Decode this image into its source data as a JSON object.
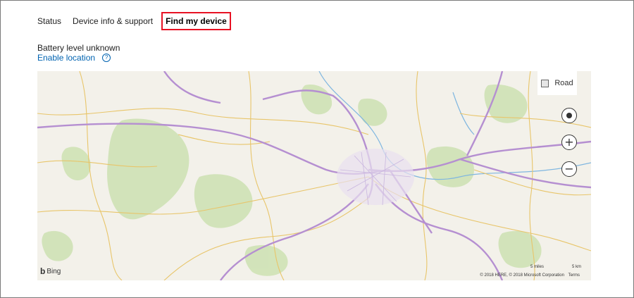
{
  "tabs": [
    {
      "label": "Status"
    },
    {
      "label": "Device info & support"
    },
    {
      "label": "Find my device"
    }
  ],
  "battery_text": "Battery level unknown",
  "enable_location": "Enable location",
  "help_icon": "?",
  "map": {
    "road_label": "Road",
    "bing_label": "Bing",
    "scale": [
      "5 miles",
      "5 km"
    ],
    "copyright": "© 2018 HERE, © 2018 Microsoft Corporation",
    "terms": "Terms"
  },
  "colors": {
    "accent_link": "#0063b1",
    "active_tab_border": "#e81123",
    "map_base": "#f3f1ea",
    "major_road": "#b58fd1",
    "secondary_road": "#e8c56a",
    "green_area": "#cfe2b5"
  }
}
